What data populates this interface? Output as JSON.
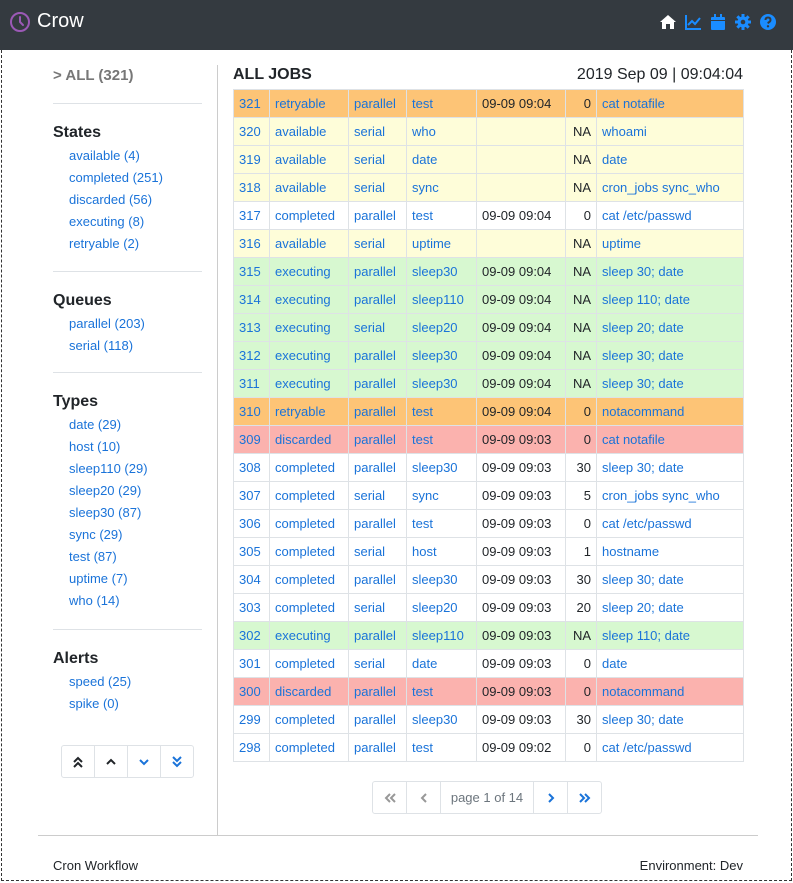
{
  "app": {
    "title": "Crow",
    "accent": "#9b59b6",
    "link_color": "#1a73d9"
  },
  "nav_icons": [
    "home-icon",
    "chart-line-icon",
    "calendar-icon",
    "gear-icon",
    "help-icon"
  ],
  "sidebar": {
    "all_label": "> ALL (321)",
    "states": {
      "heading": "States",
      "items": [
        "available (4)",
        "completed (251)",
        "discarded (56)",
        "executing (8)",
        "retryable (2)"
      ]
    },
    "queues": {
      "heading": "Queues",
      "items": [
        "parallel (203)",
        "serial (118)"
      ]
    },
    "types": {
      "heading": "Types",
      "items": [
        "date (29)",
        "host (10)",
        "sleep110 (29)",
        "sleep20 (29)",
        "sleep30 (87)",
        "sync (29)",
        "test (87)",
        "uptime (7)",
        "who (14)"
      ]
    },
    "alerts": {
      "heading": "Alerts",
      "items": [
        "speed (25)",
        "spike (0)"
      ]
    },
    "scroll_buttons": [
      "double-chevron-up-icon",
      "chevron-up-icon",
      "chevron-down-icon",
      "double-chevron-down-icon"
    ]
  },
  "main": {
    "title": "ALL JOBS",
    "datetime": "2019 Sep 09 | 09:04:04",
    "row_colors": {
      "retryable": "#fdc476",
      "available": "#fefdd9",
      "executing": "#d7f8d0",
      "discarded": "#fbb2ae",
      "completed": "#ffffff"
    },
    "jobs": [
      [
        "321",
        "retryable",
        "parallel",
        "test",
        "09-09 09:04",
        "0",
        "cat notafile"
      ],
      [
        "320",
        "available",
        "serial",
        "who",
        "",
        "NA",
        "whoami"
      ],
      [
        "319",
        "available",
        "serial",
        "date",
        "",
        "NA",
        "date"
      ],
      [
        "318",
        "available",
        "serial",
        "sync",
        "",
        "NA",
        "cron_jobs sync_who"
      ],
      [
        "317",
        "completed",
        "parallel",
        "test",
        "09-09 09:04",
        "0",
        "cat /etc/passwd"
      ],
      [
        "316",
        "available",
        "serial",
        "uptime",
        "",
        "NA",
        "uptime"
      ],
      [
        "315",
        "executing",
        "parallel",
        "sleep30",
        "09-09 09:04",
        "NA",
        "sleep 30; date"
      ],
      [
        "314",
        "executing",
        "parallel",
        "sleep110",
        "09-09 09:04",
        "NA",
        "sleep 110; date"
      ],
      [
        "313",
        "executing",
        "serial",
        "sleep20",
        "09-09 09:04",
        "NA",
        "sleep 20; date"
      ],
      [
        "312",
        "executing",
        "parallel",
        "sleep30",
        "09-09 09:04",
        "NA",
        "sleep 30; date"
      ],
      [
        "311",
        "executing",
        "parallel",
        "sleep30",
        "09-09 09:04",
        "NA",
        "sleep 30; date"
      ],
      [
        "310",
        "retryable",
        "parallel",
        "test",
        "09-09 09:04",
        "0",
        "notacommand"
      ],
      [
        "309",
        "discarded",
        "parallel",
        "test",
        "09-09 09:03",
        "0",
        "cat notafile"
      ],
      [
        "308",
        "completed",
        "parallel",
        "sleep30",
        "09-09 09:03",
        "30",
        "sleep 30; date"
      ],
      [
        "307",
        "completed",
        "serial",
        "sync",
        "09-09 09:03",
        "5",
        "cron_jobs sync_who"
      ],
      [
        "306",
        "completed",
        "parallel",
        "test",
        "09-09 09:03",
        "0",
        "cat /etc/passwd"
      ],
      [
        "305",
        "completed",
        "serial",
        "host",
        "09-09 09:03",
        "1",
        "hostname"
      ],
      [
        "304",
        "completed",
        "parallel",
        "sleep30",
        "09-09 09:03",
        "30",
        "sleep 30; date"
      ],
      [
        "303",
        "completed",
        "serial",
        "sleep20",
        "09-09 09:03",
        "20",
        "sleep 20; date"
      ],
      [
        "302",
        "executing",
        "parallel",
        "sleep110",
        "09-09 09:03",
        "NA",
        "sleep 110; date"
      ],
      [
        "301",
        "completed",
        "serial",
        "date",
        "09-09 09:03",
        "0",
        "date"
      ],
      [
        "300",
        "discarded",
        "parallel",
        "test",
        "09-09 09:03",
        "0",
        "notacommand"
      ],
      [
        "299",
        "completed",
        "parallel",
        "sleep30",
        "09-09 09:03",
        "30",
        "sleep 30; date"
      ],
      [
        "298",
        "completed",
        "parallel",
        "test",
        "09-09 09:02",
        "0",
        "cat /etc/passwd"
      ]
    ]
  },
  "pagination": {
    "info": "page 1 of 14",
    "buttons": [
      "first-page-icon",
      "prev-page-icon",
      "next-page-icon",
      "last-page-icon"
    ]
  },
  "footer": {
    "left": "Cron Workflow",
    "right": "Environment: Dev"
  }
}
